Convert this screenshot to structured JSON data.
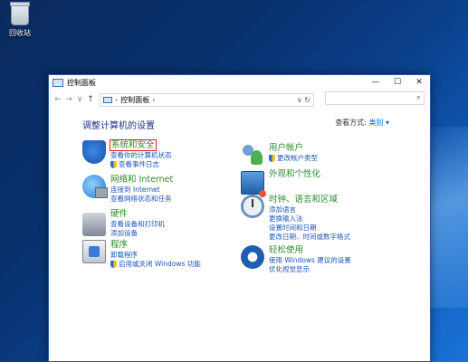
{
  "desktop": {
    "recycle_bin_label": "回收站"
  },
  "window": {
    "title": "控制面板",
    "controls": {
      "minimize": "—",
      "maximize": "☐",
      "close": "✕"
    }
  },
  "nav": {
    "back": "←",
    "forward": "→",
    "dropdown": "∨",
    "up": "↑",
    "breadcrumb_sep": "›",
    "breadcrumb": "控制面板",
    "breadcrumb_tail": "›",
    "addr_dropdown": "∨",
    "refresh": "↻",
    "search_placeholder": "",
    "search_icon": "⌕"
  },
  "content": {
    "heading": "调整计算机的设置",
    "view_by_label": "查看方式:",
    "view_by_value": "类别 ▾",
    "categories_left": [
      {
        "title": "系统和安全",
        "icon": "shield-icon",
        "links": [
          "查看你的计算机状态",
          "查看事件日志"
        ],
        "shield_link": 1
      },
      {
        "title": "网络和 Internet",
        "icon": "network-icon",
        "links": [
          "连接到 Internet",
          "查看网络状态和任务"
        ]
      },
      {
        "title": "硬件",
        "icon": "printer-icon",
        "links": [
          "查看设备和打印机",
          "添加设备"
        ]
      },
      {
        "title": "程序",
        "icon": "programs-icon",
        "links": [
          "卸载程序",
          "启用或关闭 Windows 功能"
        ],
        "shield_link": 1
      }
    ],
    "categories_right": [
      {
        "title": "用户帐户",
        "icon": "users-icon",
        "links": [
          "更改帐户类型"
        ],
        "shield_link": 0
      },
      {
        "title": "外观和个性化",
        "icon": "appearance-icon",
        "links": []
      },
      {
        "title": "时钟、语言和区域",
        "icon": "clock-icon",
        "links": [
          "添加语言",
          "更换输入法",
          "设置时间和日期",
          "更改日期、时间或数字格式"
        ]
      },
      {
        "title": "轻松使用",
        "icon": "ease-of-access-icon",
        "links": [
          "使用 Windows 建议的设置",
          "优化视觉显示"
        ]
      }
    ]
  }
}
